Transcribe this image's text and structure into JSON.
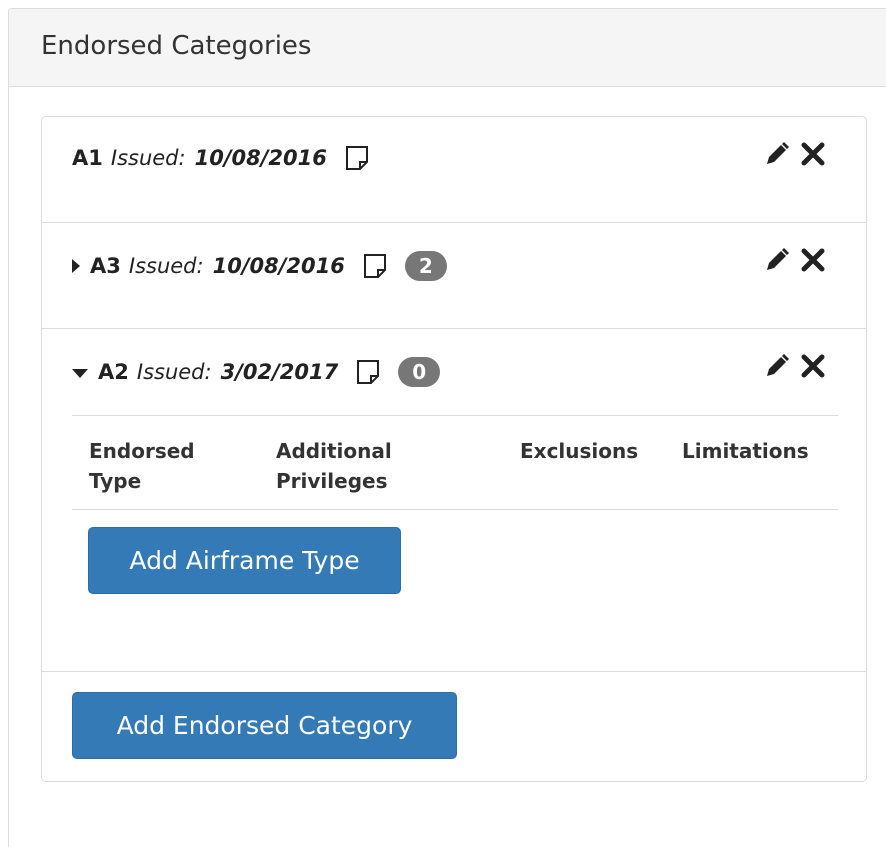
{
  "panel": {
    "title": "Endorsed Categories"
  },
  "categories": [
    {
      "code": "A1",
      "issued_label": "Issued:",
      "issued_date": "10/08/2016",
      "expanded": null,
      "badge": null
    },
    {
      "code": "A3",
      "issued_label": "Issued:",
      "issued_date": "10/08/2016",
      "expanded": false,
      "badge": "2"
    },
    {
      "code": "A2",
      "issued_label": "Issued:",
      "issued_date": "3/02/2017",
      "expanded": true,
      "badge": "0"
    }
  ],
  "type_table": {
    "col_endorsed_type": "Endorsed Type",
    "col_additional_privileges": "Additional Privileges",
    "col_exclusions": "Exclusions",
    "col_limitations": "Limitations"
  },
  "buttons": {
    "add_airframe_type": "Add Airframe Type",
    "add_endorsed_category": "Add Endorsed Category"
  },
  "icons": {
    "note": "note-icon",
    "edit": "pencil-icon",
    "delete": "close-icon",
    "expand": "caret-icon"
  },
  "colors": {
    "primary": "#337ab7",
    "badge": "#777777",
    "heading_bg": "#f5f5f5",
    "border": "#dcdcdc"
  }
}
